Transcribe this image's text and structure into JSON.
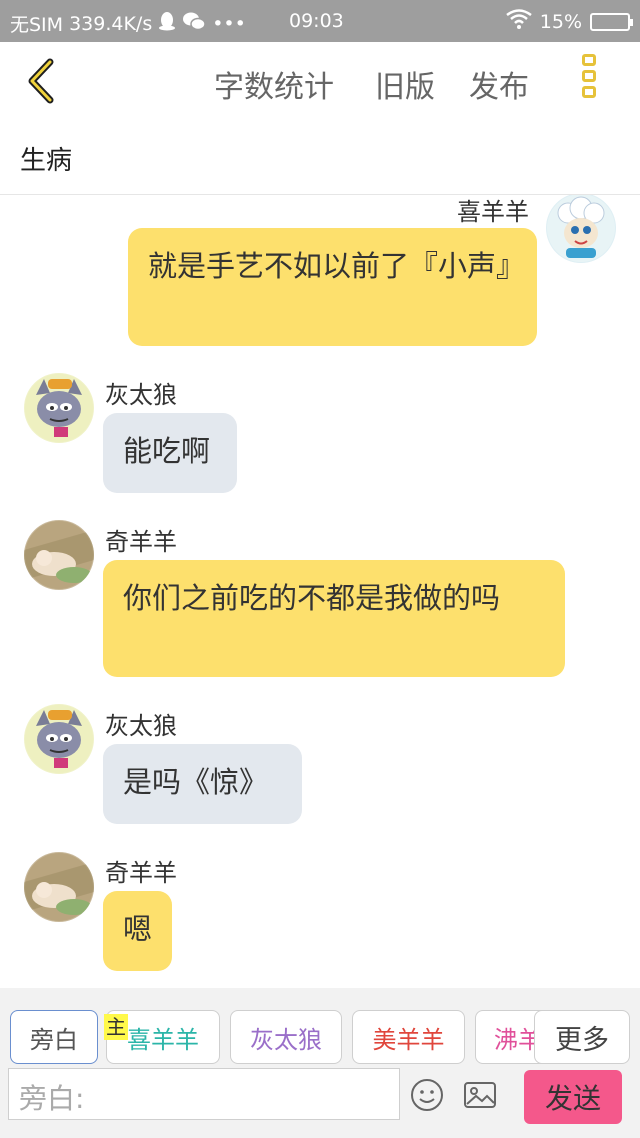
{
  "status_bar": {
    "carrier": "无SIM",
    "speed": "339.4K/s",
    "dots": "•••",
    "time": "09:03",
    "battery": "15%"
  },
  "top_bar": {
    "word_count": "字数统计",
    "old_version": "旧版",
    "publish": "发布"
  },
  "story_title": "生病",
  "messages": [
    {
      "speaker": "喜羊羊",
      "text": "就是手艺不如以前了『小声』",
      "side": "right",
      "color": "yellow"
    },
    {
      "speaker": "灰太狼",
      "text": "能吃啊",
      "side": "left",
      "color": "grey"
    },
    {
      "speaker": "奇羊羊",
      "text": "你们之前吃的不都是我做的吗",
      "side": "left",
      "color": "yellow"
    },
    {
      "speaker": "灰太狼",
      "text": "是吗《惊》",
      "side": "left",
      "color": "grey"
    },
    {
      "speaker": "奇羊羊",
      "text": "嗯",
      "side": "left",
      "color": "yellow"
    }
  ],
  "role_chips": [
    {
      "label": "旁白",
      "color": "#555555"
    },
    {
      "label": "喜羊羊",
      "color": "#2bb5a8"
    },
    {
      "label": "灰太狼",
      "color": "#9a6fc9"
    },
    {
      "label": "美羊羊",
      "color": "#e0463c"
    },
    {
      "label": "沸羊羊",
      "color": "#e0509a"
    }
  ],
  "main_tag": "主",
  "more_label": "更多",
  "input_placeholder": "旁白:",
  "send_label": "发送",
  "colors": {
    "accent_yellow": "#e6c23a",
    "bubble_yellow": "#fde06d",
    "bubble_grey": "#e3e8ee",
    "send_pink": "#f4588b"
  },
  "icons": [
    "back-icon",
    "menu-icon",
    "emoji-icon",
    "image-icon",
    "wifi-icon",
    "qq-icon",
    "wechat-icon"
  ]
}
